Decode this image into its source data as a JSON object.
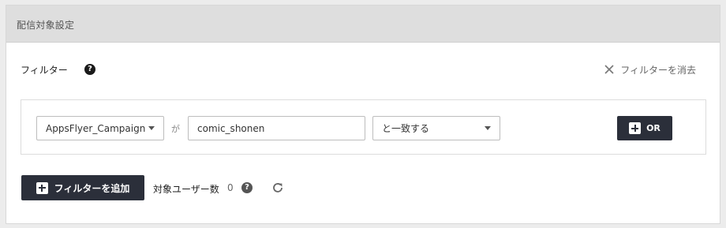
{
  "panel": {
    "title": "配信対象設定"
  },
  "filter_header": {
    "label": "フィルター",
    "help_symbol": "?",
    "clear_label": "フィルターを消去",
    "clear_icon": "close-icon"
  },
  "condition": {
    "attribute_value": "AppsFlyer_Campaign",
    "connector": "が",
    "text_value": "comic_shonen",
    "operator_value": "と一致する",
    "or_label": "OR"
  },
  "footer": {
    "add_filter_label": "フィルターを追加",
    "user_count_label": "対象ユーザー数",
    "user_count_value": "0",
    "help_symbol": "?",
    "refresh_icon": "refresh-icon"
  },
  "colors": {
    "button_dark": "#2b2f3a",
    "header_bg": "#dedede",
    "page_bg": "#ececec"
  }
}
